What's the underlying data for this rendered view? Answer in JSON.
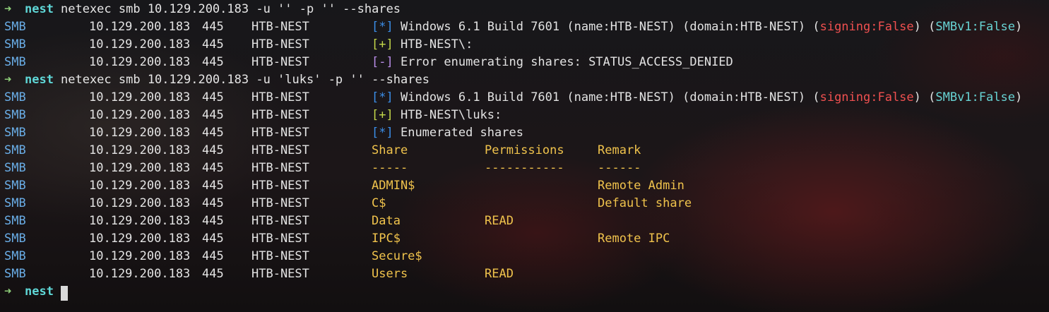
{
  "prompt": {
    "arrow": "➜",
    "dir": "nest"
  },
  "commands": [
    "netexec smb 10.129.200.183 -u '' -p '' --shares",
    "netexec smb 10.129.200.183 -u 'luks' -p '' --shares"
  ],
  "row": {
    "proto": "SMB",
    "ip": "10.129.200.183",
    "port": "445",
    "host": "HTB-NEST"
  },
  "run1": {
    "info_mark": "[*]",
    "info_pre": "Windows 6.1 Build 7601 (name:HTB-NEST) (domain:HTB-NEST) (",
    "signing": "signing:False",
    "info_mid": ") (",
    "smbv1": "SMBv1:False",
    "info_end": ")",
    "auth_mark": "[+]",
    "auth_text": "HTB-NEST\\:",
    "err_mark": "[-]",
    "err_text": "Error enumerating shares: STATUS_ACCESS_DENIED"
  },
  "run2": {
    "info_mark": "[*]",
    "info_pre": "Windows 6.1 Build 7601 (name:HTB-NEST) (domain:HTB-NEST) (",
    "signing": "signing:False",
    "info_mid": ") (",
    "smbv1": "SMBv1:False",
    "info_end": ")",
    "auth_mark": "[+]",
    "auth_text": "HTB-NEST\\luks:",
    "enum_mark": "[*]",
    "enum_text": "Enumerated shares"
  },
  "table": {
    "headers": [
      "Share",
      "Permissions",
      "Remark"
    ],
    "separators": [
      "-----",
      "-----------",
      "------"
    ],
    "rows": [
      {
        "share": "ADMIN$",
        "perm": "",
        "remark": "Remote Admin"
      },
      {
        "share": "C$",
        "perm": "",
        "remark": "Default share"
      },
      {
        "share": "Data",
        "perm": "READ",
        "remark": ""
      },
      {
        "share": "IPC$",
        "perm": "",
        "remark": "Remote IPC"
      },
      {
        "share": "Secure$",
        "perm": "",
        "remark": ""
      },
      {
        "share": "Users",
        "perm": "READ",
        "remark": ""
      }
    ]
  },
  "colors": {
    "prompt_arrow": "#8fd07a",
    "prompt_dir": "#5fd7d7",
    "proto": "#6aaee8",
    "info": "#3b8ee8",
    "success": "#c4d84a",
    "error": "#b98de8",
    "table": "#f0c34c",
    "signing": "#f05050",
    "smbv1": "#67d3d3"
  }
}
